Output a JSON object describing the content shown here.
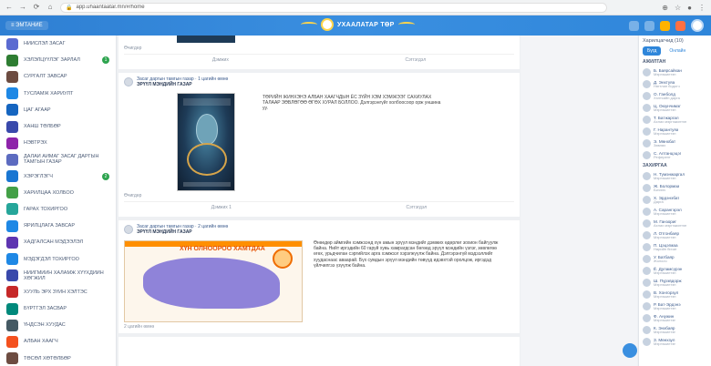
{
  "browser": {
    "url": "app.uhaantaatar.mn/#/home",
    "nav_back": "←",
    "nav_forward": "→",
    "nav_reload": "⟳",
    "nav_home": "⌂"
  },
  "header": {
    "menu_label": "≡ ЭМТАНИЕ",
    "logo_text": "УХААЛАТАР ТӨР"
  },
  "sidebar": {
    "items": [
      {
        "label": "НИЙСЛЭЛ ЗАСАГ",
        "color": "#5b6bd1"
      },
      {
        "label": "ХЭЛЭЛЦҮҮЛЭГ ЗАРЛАЛ",
        "color": "#2e7d32",
        "badge": "1"
      },
      {
        "label": "СУРГАЛТ ЗАВСАР",
        "color": "#6d4c41"
      },
      {
        "label": "ТУСЛАМЖ ХАРИУЛТ",
        "color": "#1e88e5"
      },
      {
        "label": "ЦАГ АГААР",
        "color": "#1565c0"
      },
      {
        "label": "ХАНШ ТӨЛБӨР",
        "color": "#3949ab"
      },
      {
        "label": "НЭВТРЭХ",
        "color": "#8e24aa"
      },
      {
        "label": "ДАЛАЙ АЙМАГ ЗАСАГ ДАРГЫН ТАМГЫН ГАЗАР",
        "color": "#5c6bc0"
      },
      {
        "label": "ХЭРЭГЛЭГЧ",
        "color": "#1976d2",
        "badge": "2"
      },
      {
        "label": "ХАРИЛЦАА ХОЛБОО",
        "color": "#43a047"
      },
      {
        "label": "ГАРАХ ТОХИРГОО",
        "color": "#26a69a"
      },
      {
        "label": "ЯРИЛЦЛАГА ЗАВСАР",
        "color": "#1e88e5"
      },
      {
        "label": "ХАДГАЛСАН МЭДЭЭЛЭЛ",
        "color": "#5e35b1"
      },
      {
        "label": "МЭДЭГДЭЛ ТОХИРГОО",
        "color": "#1e88e5"
      },
      {
        "label": "НИЙГМИЙН ХАЛАМЖ ХҮҮХДИЙН ХӨГЖИЛ",
        "color": "#3949ab"
      },
      {
        "label": "ХУУЛЬ ЭРХ ЗҮЙН ХЭЛТЭС",
        "color": "#c62828"
      },
      {
        "label": "БҮРТГЭЛ ЗАСВАР",
        "color": "#00897b"
      },
      {
        "label": "ҮНДСЭН ХУУДАС",
        "color": "#455a64"
      },
      {
        "label": "АЛБАН ХААГЧ",
        "color": "#f4511e"
      },
      {
        "label": "ТӨСӨЛ ХӨТӨЛБӨР",
        "color": "#6d4c41"
      }
    ]
  },
  "feed": {
    "top_meta_left": "Өчигдөр",
    "top_actions": [
      "Дэмжих",
      "Сэтгэгдэл"
    ],
    "posts": [
      {
        "author_line": "Засаг даргын тамгын газар · 1 цагийн өмнө",
        "author_title": "ЭРҮҮЛ МЭНДИЙН ГАЗАР",
        "text": "ТӨРИЙН ЖИНХЭНЭ АЛБАН ХААГЧДЫН ЁС ЗҮЙН ХЭМ ХЭМЖЭЭГ САХИУЛАХ ТАЛААР ЗӨВЛӨГӨӨ ӨГӨХ ХУРАЛ БОЛЛОО. Дэлгэрэнгүйг холбоосоор орж уншина уу.",
        "actions": [
          "Дэмжих 1",
          "Сэтгэгдэл"
        ],
        "meta": "Өчигдөр"
      },
      {
        "author_line": "Засаг даргын тамгын газар · 2 цагийн өмнө",
        "author_title": "ЭРҮҮЛ МЭНДИЙН ГАЗАР",
        "poster_title": "ХҮН ОЛНООРОО ХАМТДАА",
        "text": "Өнөөдөр аймгийн хэмжээнд хүн амын эрүүл мэндийг дэмжих өдөрлөг зохион байгуулж байна. Нийт иргэдийн 60 гаруй хувь хамрагдсан бөгөөд эрүүл мэндийн үзлэг, зөвлөгөө өгөх, урьдчилан сэргийлэх арга хэмжээг хэрэгжүүлж байна. Дэлгэрэнгүй мэдээллийг хуудаснаас аваарай. Бүх сумдын эрүүл мэндийн төвүүд идэвхтэй оролцож, иргэдэд үйлчилгээ үзүүлж байна.",
        "actions": [
          "Дэмжих",
          "Сэтгэгдэл"
        ],
        "meta": "2 цагийн өмнө"
      }
    ]
  },
  "right_panel": {
    "title": "Харилцагчид (10)",
    "tabs": [
      "Бүгд",
      "Онлайн"
    ],
    "section1": "АЖИЛТАН",
    "section2": "ЗАХИРГАА",
    "people": [
      {
        "name": "Б. Баярсайхан",
        "sub": "Мэргэжилтэн"
      },
      {
        "name": "Д. Энхтуяа",
        "sub": "Нягтлан бодогч"
      },
      {
        "name": "О. Ганболд",
        "sub": "Хэлтсийн дарга"
      },
      {
        "name": "Ц. Оюунчимэг",
        "sub": "Мэргэжилтэн"
      },
      {
        "name": "Т. Батжаргал",
        "sub": "Ахлах мэргэжилтэн"
      },
      {
        "name": "Г. Нарантуяа",
        "sub": "Мэргэжилтэн"
      },
      {
        "name": "Э. Мөнхбат",
        "sub": "Зөвлөх"
      },
      {
        "name": "С. Алтанцэцэг",
        "sub": "Референт"
      },
      {
        "name": "Н. Түмэнжаргал",
        "sub": "Мэргэжилтэн"
      },
      {
        "name": "Ж. Болормаа",
        "sub": "Бичээч"
      },
      {
        "name": "Х. Эрдэнэбат",
        "sub": "Дарга"
      },
      {
        "name": "А. Сарангэрэл",
        "sub": "Мэргэжилтэн"
      },
      {
        "name": "М. Ганзориг",
        "sub": "Ахлах мэргэжилтэн"
      },
      {
        "name": "Л. Отгонбаяр",
        "sub": "Мэргэжилтэн"
      },
      {
        "name": "П. Цэцэгмаа",
        "sub": "Нарийн бичиг"
      },
      {
        "name": "У. Батбаяр",
        "sub": "Жолооч"
      },
      {
        "name": "Ё. Дуламсүрэн",
        "sub": "Мэргэжилтэн"
      },
      {
        "name": "Ш. Пүрэвдорж",
        "sub": "Мэргэжилтэн"
      },
      {
        "name": "В. Хонгорзул",
        "sub": "Мэргэжилтэн"
      },
      {
        "name": "Р. Бат-Эрдэнэ",
        "sub": "Мэргэжилтэн"
      },
      {
        "name": "Ф. Анужин",
        "sub": "Мэргэжилтэн"
      },
      {
        "name": "К. Энхбаяр",
        "sub": "Мэргэжилтэн"
      },
      {
        "name": "З. Мөнхзул",
        "sub": "Мэргэжилтэн"
      }
    ]
  },
  "colors": {
    "brand": "#2f86da",
    "badge": "#2ea44f"
  }
}
